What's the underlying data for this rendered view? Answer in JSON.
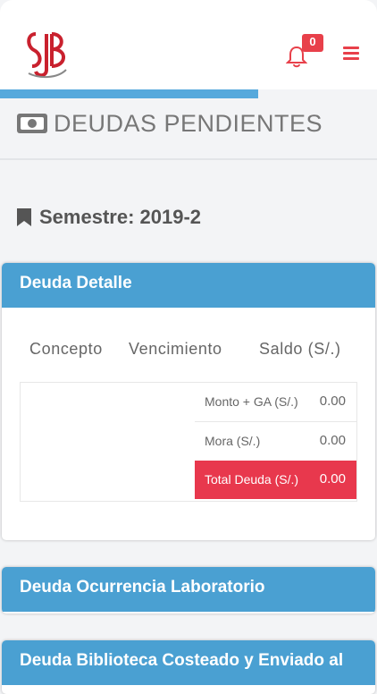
{
  "header": {
    "logo_text": "SJB",
    "notifications_count": "0"
  },
  "progress": {
    "fraction": 0.685
  },
  "page": {
    "title": "DEUDAS PENDIENTES",
    "semester": "Semestre: 2019-2"
  },
  "cards": {
    "detalle": {
      "title": "Deuda Detalle",
      "columns": [
        "Concepto",
        "Vencimiento",
        "Saldo (S/.)"
      ],
      "rows": [
        {
          "label": "Monto + GA (S/.)",
          "value": "0.00"
        },
        {
          "label": "Mora (S/.)",
          "value": "0.00"
        },
        {
          "label": "Total Deuda (S/.)",
          "value": "0.00"
        }
      ]
    },
    "laboratorio": {
      "title": "Deuda Ocurrencia Laboratorio"
    },
    "biblioteca": {
      "title": "Deuda Biblioteca Costeado y Enviado al"
    }
  },
  "colors": {
    "accent_red": "#e8384d",
    "card_blue": "#4aa0d2",
    "progress_blue": "#56a9dc"
  }
}
